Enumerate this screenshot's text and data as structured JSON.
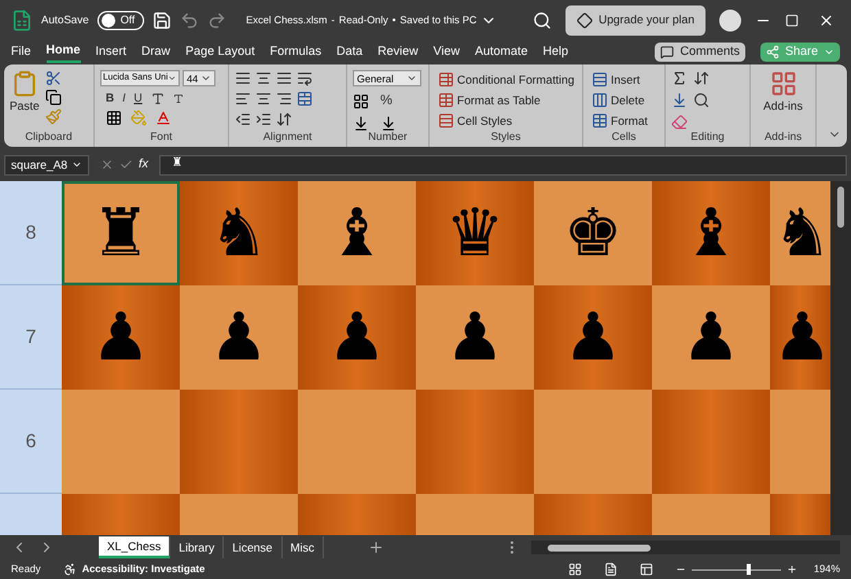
{
  "title_bar": {
    "autosave_label": "AutoSave",
    "autosave": {
      "on": false,
      "label": "Off"
    },
    "file_name": "Excel Chess.xlsm",
    "separators": [
      "-",
      "•"
    ],
    "mode": "Read-Only",
    "save_status": "Saved to this PC",
    "upgrade_button": "Upgrade your plan"
  },
  "ribbon_tabs": [
    {
      "label": "File",
      "selected": false
    },
    {
      "label": "Home",
      "selected": true
    },
    {
      "label": "Insert",
      "selected": false
    },
    {
      "label": "Draw",
      "selected": false
    },
    {
      "label": "Page Layout",
      "selected": false
    },
    {
      "label": "Formulas",
      "selected": false
    },
    {
      "label": "Data",
      "selected": false
    },
    {
      "label": "Review",
      "selected": false
    },
    {
      "label": "View",
      "selected": false
    },
    {
      "label": "Automate",
      "selected": false
    },
    {
      "label": "Help",
      "selected": false
    }
  ],
  "comments_button": "Comments",
  "share_button": "Share",
  "ribbon": {
    "clipboard": {
      "label": "Clipboard",
      "paste": "Paste"
    },
    "font": {
      "label": "Font",
      "font_name": "Lucida Sans Uni",
      "font_size": "44",
      "bold": "B",
      "italic": "I",
      "underline": "U"
    },
    "alignment": {
      "label": "Alignment"
    },
    "number": {
      "label": "Number",
      "format": "General",
      "percent": "%"
    },
    "styles": {
      "label": "Styles",
      "items": [
        "Conditional Formatting",
        "Format as Table",
        "Cell Styles"
      ]
    },
    "cells": {
      "label": "Cells",
      "items": [
        "Insert",
        "Delete",
        "Format"
      ]
    },
    "editing": {
      "label": "Editing"
    },
    "addins": {
      "label": "Add-ins",
      "button": "Add-ins"
    }
  },
  "formula_bar": {
    "name_box": "square_A8",
    "function_label": "fx",
    "content": "♜"
  },
  "board": {
    "rows": [
      {
        "label": "8",
        "cells": [
          {
            "piece": "♜",
            "selected": true
          },
          {
            "piece": "♞",
            "selected": false
          },
          {
            "piece": "♝",
            "selected": false
          },
          {
            "piece": "♛",
            "selected": false
          },
          {
            "piece": "♚",
            "selected": false
          },
          {
            "piece": "♝",
            "selected": false
          },
          {
            "piece": "♞",
            "selected": false
          }
        ]
      },
      {
        "label": "7",
        "cells": [
          {
            "piece": "♟",
            "selected": false
          },
          {
            "piece": "♟",
            "selected": false
          },
          {
            "piece": "♟",
            "selected": false
          },
          {
            "piece": "♟",
            "selected": false
          },
          {
            "piece": "♟",
            "selected": false
          },
          {
            "piece": "♟",
            "selected": false
          },
          {
            "piece": "♟",
            "selected": false
          }
        ]
      },
      {
        "label": "6",
        "cells": [
          {
            "selected": false
          },
          {
            "selected": false
          },
          {
            "selected": false
          },
          {
            "selected": false
          },
          {
            "selected": false
          },
          {
            "selected": false
          },
          {
            "selected": false
          }
        ]
      },
      {
        "cells": [
          {
            "selected": false
          },
          {
            "selected": false
          },
          {
            "selected": false
          },
          {
            "selected": false
          },
          {
            "selected": false
          },
          {
            "selected": false
          },
          {
            "selected": false
          }
        ]
      }
    ]
  },
  "sheet_tabs": [
    {
      "label": "XL_Chess",
      "selected": true
    },
    {
      "label": "Library",
      "selected": false
    },
    {
      "label": "License",
      "selected": false
    },
    {
      "label": "Misc",
      "selected": false
    }
  ],
  "status_bar": {
    "ready": "Ready",
    "accessibility": "Accessibility: Investigate",
    "zoom": {
      "level": 0.64,
      "reading": "194%"
    }
  }
}
